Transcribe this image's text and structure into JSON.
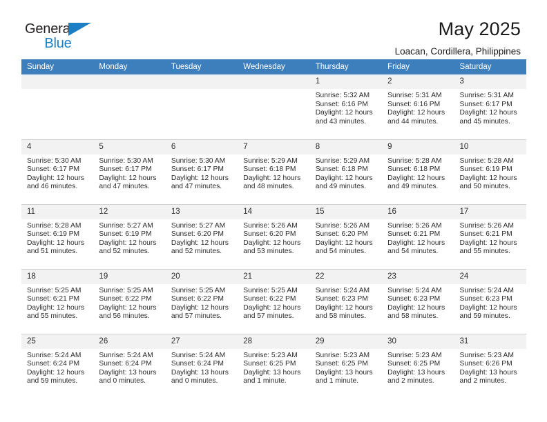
{
  "brand": {
    "line1": "General",
    "line2": "Blue",
    "accent": "#1c7fc4"
  },
  "header": {
    "title": "May 2025",
    "location": "Loacan, Cordillera, Philippines"
  },
  "theme": {
    "header_bg": "#3d7ebd",
    "daynum_bg": "#f2f2f2",
    "grid_line": "#cccccc",
    "text": "#2b2b2b"
  },
  "columns": [
    "Sunday",
    "Monday",
    "Tuesday",
    "Wednesday",
    "Thursday",
    "Friday",
    "Saturday"
  ],
  "weeks": [
    [
      {
        "day": "",
        "lines": []
      },
      {
        "day": "",
        "lines": []
      },
      {
        "day": "",
        "lines": []
      },
      {
        "day": "",
        "lines": []
      },
      {
        "day": "1",
        "lines": [
          "Sunrise: 5:32 AM",
          "Sunset: 6:16 PM",
          "Daylight: 12 hours",
          "and 43 minutes."
        ]
      },
      {
        "day": "2",
        "lines": [
          "Sunrise: 5:31 AM",
          "Sunset: 6:16 PM",
          "Daylight: 12 hours",
          "and 44 minutes."
        ]
      },
      {
        "day": "3",
        "lines": [
          "Sunrise: 5:31 AM",
          "Sunset: 6:17 PM",
          "Daylight: 12 hours",
          "and 45 minutes."
        ]
      }
    ],
    [
      {
        "day": "4",
        "lines": [
          "Sunrise: 5:30 AM",
          "Sunset: 6:17 PM",
          "Daylight: 12 hours",
          "and 46 minutes."
        ]
      },
      {
        "day": "5",
        "lines": [
          "Sunrise: 5:30 AM",
          "Sunset: 6:17 PM",
          "Daylight: 12 hours",
          "and 47 minutes."
        ]
      },
      {
        "day": "6",
        "lines": [
          "Sunrise: 5:30 AM",
          "Sunset: 6:17 PM",
          "Daylight: 12 hours",
          "and 47 minutes."
        ]
      },
      {
        "day": "7",
        "lines": [
          "Sunrise: 5:29 AM",
          "Sunset: 6:18 PM",
          "Daylight: 12 hours",
          "and 48 minutes."
        ]
      },
      {
        "day": "8",
        "lines": [
          "Sunrise: 5:29 AM",
          "Sunset: 6:18 PM",
          "Daylight: 12 hours",
          "and 49 minutes."
        ]
      },
      {
        "day": "9",
        "lines": [
          "Sunrise: 5:28 AM",
          "Sunset: 6:18 PM",
          "Daylight: 12 hours",
          "and 49 minutes."
        ]
      },
      {
        "day": "10",
        "lines": [
          "Sunrise: 5:28 AM",
          "Sunset: 6:19 PM",
          "Daylight: 12 hours",
          "and 50 minutes."
        ]
      }
    ],
    [
      {
        "day": "11",
        "lines": [
          "Sunrise: 5:28 AM",
          "Sunset: 6:19 PM",
          "Daylight: 12 hours",
          "and 51 minutes."
        ]
      },
      {
        "day": "12",
        "lines": [
          "Sunrise: 5:27 AM",
          "Sunset: 6:19 PM",
          "Daylight: 12 hours",
          "and 52 minutes."
        ]
      },
      {
        "day": "13",
        "lines": [
          "Sunrise: 5:27 AM",
          "Sunset: 6:20 PM",
          "Daylight: 12 hours",
          "and 52 minutes."
        ]
      },
      {
        "day": "14",
        "lines": [
          "Sunrise: 5:26 AM",
          "Sunset: 6:20 PM",
          "Daylight: 12 hours",
          "and 53 minutes."
        ]
      },
      {
        "day": "15",
        "lines": [
          "Sunrise: 5:26 AM",
          "Sunset: 6:20 PM",
          "Daylight: 12 hours",
          "and 54 minutes."
        ]
      },
      {
        "day": "16",
        "lines": [
          "Sunrise: 5:26 AM",
          "Sunset: 6:21 PM",
          "Daylight: 12 hours",
          "and 54 minutes."
        ]
      },
      {
        "day": "17",
        "lines": [
          "Sunrise: 5:26 AM",
          "Sunset: 6:21 PM",
          "Daylight: 12 hours",
          "and 55 minutes."
        ]
      }
    ],
    [
      {
        "day": "18",
        "lines": [
          "Sunrise: 5:25 AM",
          "Sunset: 6:21 PM",
          "Daylight: 12 hours",
          "and 55 minutes."
        ]
      },
      {
        "day": "19",
        "lines": [
          "Sunrise: 5:25 AM",
          "Sunset: 6:22 PM",
          "Daylight: 12 hours",
          "and 56 minutes."
        ]
      },
      {
        "day": "20",
        "lines": [
          "Sunrise: 5:25 AM",
          "Sunset: 6:22 PM",
          "Daylight: 12 hours",
          "and 57 minutes."
        ]
      },
      {
        "day": "21",
        "lines": [
          "Sunrise: 5:25 AM",
          "Sunset: 6:22 PM",
          "Daylight: 12 hours",
          "and 57 minutes."
        ]
      },
      {
        "day": "22",
        "lines": [
          "Sunrise: 5:24 AM",
          "Sunset: 6:23 PM",
          "Daylight: 12 hours",
          "and 58 minutes."
        ]
      },
      {
        "day": "23",
        "lines": [
          "Sunrise: 5:24 AM",
          "Sunset: 6:23 PM",
          "Daylight: 12 hours",
          "and 58 minutes."
        ]
      },
      {
        "day": "24",
        "lines": [
          "Sunrise: 5:24 AM",
          "Sunset: 6:23 PM",
          "Daylight: 12 hours",
          "and 59 minutes."
        ]
      }
    ],
    [
      {
        "day": "25",
        "lines": [
          "Sunrise: 5:24 AM",
          "Sunset: 6:24 PM",
          "Daylight: 12 hours",
          "and 59 minutes."
        ]
      },
      {
        "day": "26",
        "lines": [
          "Sunrise: 5:24 AM",
          "Sunset: 6:24 PM",
          "Daylight: 13 hours",
          "and 0 minutes."
        ]
      },
      {
        "day": "27",
        "lines": [
          "Sunrise: 5:24 AM",
          "Sunset: 6:24 PM",
          "Daylight: 13 hours",
          "and 0 minutes."
        ]
      },
      {
        "day": "28",
        "lines": [
          "Sunrise: 5:23 AM",
          "Sunset: 6:25 PM",
          "Daylight: 13 hours",
          "and 1 minute."
        ]
      },
      {
        "day": "29",
        "lines": [
          "Sunrise: 5:23 AM",
          "Sunset: 6:25 PM",
          "Daylight: 13 hours",
          "and 1 minute."
        ]
      },
      {
        "day": "30",
        "lines": [
          "Sunrise: 5:23 AM",
          "Sunset: 6:25 PM",
          "Daylight: 13 hours",
          "and 2 minutes."
        ]
      },
      {
        "day": "31",
        "lines": [
          "Sunrise: 5:23 AM",
          "Sunset: 6:26 PM",
          "Daylight: 13 hours",
          "and 2 minutes."
        ]
      }
    ]
  ]
}
